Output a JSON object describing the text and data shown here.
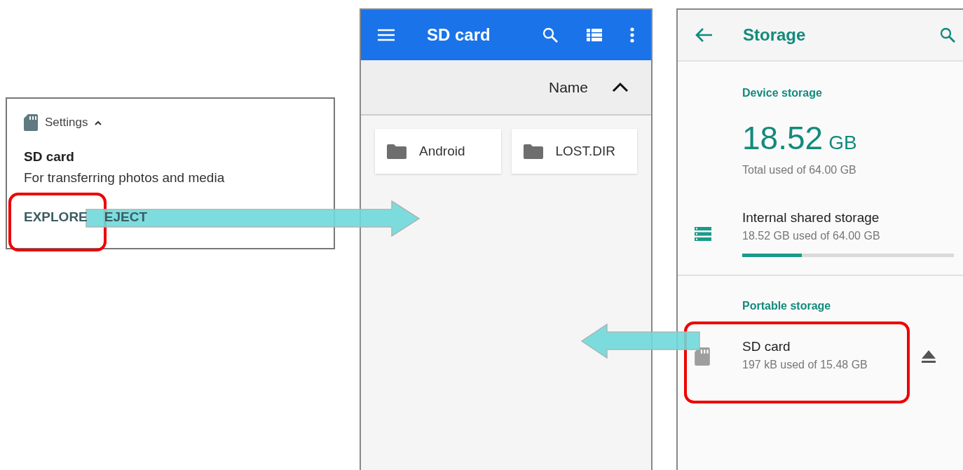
{
  "notification": {
    "app": "Settings",
    "title": "SD card",
    "text": "For transferring photos and media",
    "actions": [
      "EXPLORE",
      "EJECT"
    ]
  },
  "files_app": {
    "title": "SD card",
    "sort_label": "Name",
    "folders": [
      "Android",
      "LOST.DIR"
    ]
  },
  "storage": {
    "title": "Storage",
    "device_section": "Device storage",
    "used_value": "18.52",
    "used_unit": "GB",
    "used_caption": "Total used of 64.00 GB",
    "internal": {
      "title": "Internal shared storage",
      "summary": "18.52 GB used of 64.00 GB",
      "level": 0.28
    },
    "portable_section": "Portable storage",
    "sd": {
      "title": "SD card",
      "summary": "197 kB used of 15.48 GB"
    }
  }
}
